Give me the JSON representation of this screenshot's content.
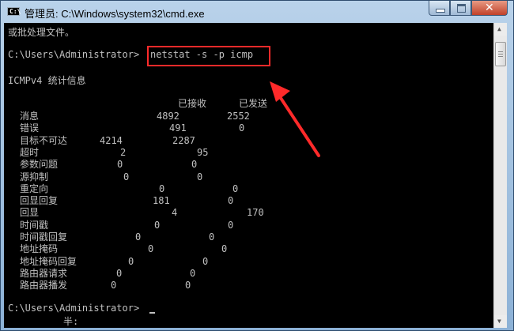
{
  "window": {
    "title": "管理员: C:\\Windows\\system32\\cmd.exe",
    "icon_label": "C:\\",
    "minimize_icon": "minimize-icon",
    "maximize_icon": "maximize-icon",
    "close_icon": "close-icon",
    "close_glyph": "✕"
  },
  "console": {
    "line_prev": "或批处理文件。",
    "prompt1": "C:\\Users\\Administrator>",
    "command": "netstat -s -p icmp",
    "section_title": "ICMPv4 统计信息",
    "col_received": "已接收",
    "col_sent": "已发送",
    "rows": [
      {
        "label": "消息",
        "received": "4892",
        "sent": "2552"
      },
      {
        "label": "错误",
        "received": "491",
        "sent": "0"
      },
      {
        "label": "目标不可达",
        "received": "4214",
        "sent": "2287"
      },
      {
        "label": "超时",
        "received": "2",
        "sent": "95"
      },
      {
        "label": "参数问题",
        "received": "0",
        "sent": "0"
      },
      {
        "label": "源抑制",
        "received": "0",
        "sent": "0"
      },
      {
        "label": "重定向",
        "received": "0",
        "sent": "0"
      },
      {
        "label": "回显回复",
        "received": "181",
        "sent": "0"
      },
      {
        "label": "回显",
        "received": "4",
        "sent": "170"
      },
      {
        "label": "时间戳",
        "received": "0",
        "sent": "0"
      },
      {
        "label": "时间戳回复",
        "received": "0",
        "sent": "0"
      },
      {
        "label": "地址掩码",
        "received": "0",
        "sent": "0"
      },
      {
        "label": "地址掩码回复",
        "received": "0",
        "sent": "0"
      },
      {
        "label": "路由器请求",
        "received": "0",
        "sent": "0"
      },
      {
        "label": "路由器播发",
        "received": "0",
        "sent": "0"
      }
    ],
    "prompt2": "C:\\Users\\Administrator>",
    "ime_text": "半:"
  },
  "annotation": {
    "color": "#ff2a2a"
  }
}
